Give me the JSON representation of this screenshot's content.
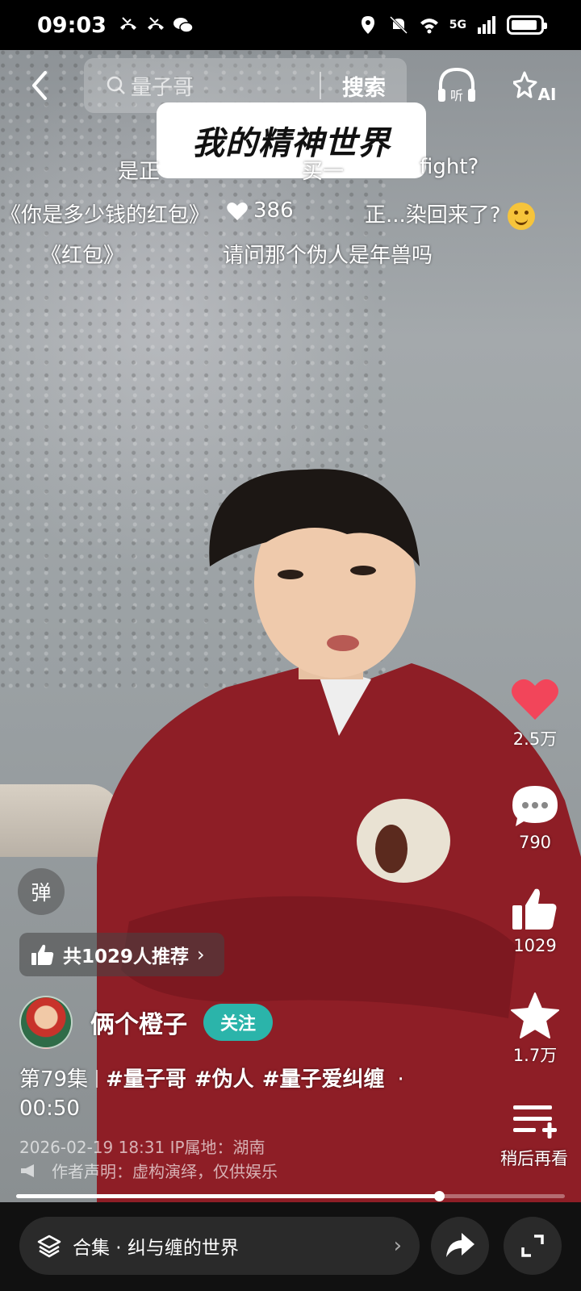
{
  "status_bar": {
    "time": "09:03",
    "network": "5G",
    "battery_level": 0.9
  },
  "top_bar": {
    "search_text": "量子哥",
    "search_button": "搜索",
    "listen_label": "听",
    "ai_label": "AI"
  },
  "video": {
    "overlay_title": "我的精神世界",
    "progress_fraction": 0.77
  },
  "danmaku": [
    {
      "text": "是正"
    },
    {
      "text": "买一"
    },
    {
      "text": "fight?"
    },
    {
      "text": "《你是多少钱的红包》"
    },
    {
      "text": "386"
    },
    {
      "text": "正...染回来了?"
    },
    {
      "text": "《红包》"
    },
    {
      "text": "请问那个伪人是年兽吗"
    }
  ],
  "right_rail": {
    "likes": "2.5万",
    "comments": "790",
    "recommends": "1029",
    "favorites": "1.7万",
    "watch_later": "稍后再看"
  },
  "left_panel": {
    "danmu_toggle": "弹",
    "recommend_text": "共1029人推荐",
    "author_name": "俩个橙子",
    "follow_label": "关注",
    "episode": "第79集",
    "tags": [
      "#量子哥",
      "#伪人",
      "#量子爱纠缠"
    ],
    "duration": "00:50",
    "meta": "2026-02-19 18:31  IP属地：湖南",
    "disclaimer": "作者声明：虚构演绎，仅供娱乐"
  },
  "bottom_bar": {
    "collection_label": "合集 · 纠与缠的世界"
  },
  "icons": [
    "back-icon",
    "search-icon",
    "headphones-icon",
    "ai-sparkle-icon",
    "heart-icon",
    "comment-icon",
    "thumbs-up-icon",
    "star-icon",
    "watch-later-icon",
    "layers-icon",
    "share-icon",
    "fullscreen-icon"
  ],
  "colors": {
    "like_red": "#f2455a",
    "follow_teal": "#2bb4aa"
  }
}
